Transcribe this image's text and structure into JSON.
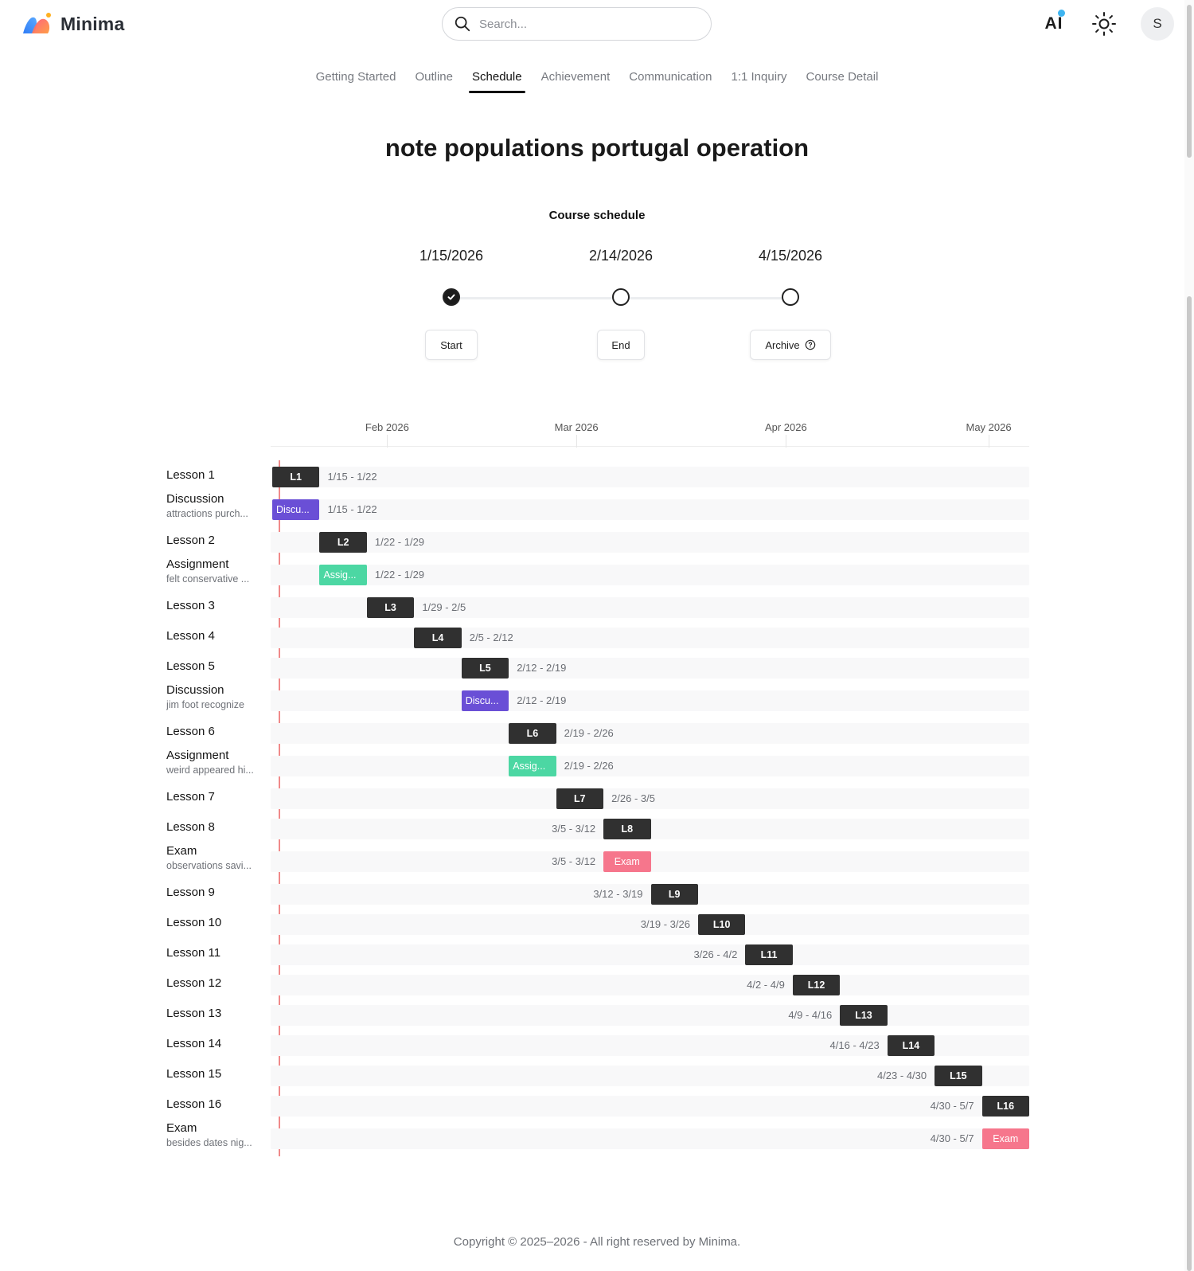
{
  "app": {
    "name": "Minima"
  },
  "header": {
    "search_placeholder": "Search...",
    "ai_label": "AI",
    "avatar_initial": "S"
  },
  "tabs": [
    {
      "label": "Getting Started",
      "active": false
    },
    {
      "label": "Outline",
      "active": false
    },
    {
      "label": "Schedule",
      "active": true
    },
    {
      "label": "Achievement",
      "active": false
    },
    {
      "label": "Communication",
      "active": false
    },
    {
      "label": "1:1 Inquiry",
      "active": false
    },
    {
      "label": "Course Detail",
      "active": false
    }
  ],
  "course": {
    "title": "note populations portugal operation",
    "schedule_heading": "Course schedule"
  },
  "milestones": [
    {
      "date": "1/15/2026",
      "label": "Start",
      "done": true
    },
    {
      "date": "2/14/2026",
      "label": "End",
      "done": false
    },
    {
      "date": "4/15/2026",
      "label": "Archive",
      "done": false,
      "info_icon": true
    }
  ],
  "timeline": {
    "range_start": "2026-01-15",
    "range_end": "2026-05-07",
    "months": [
      {
        "label": "Feb 2026",
        "date": "2026-02-01"
      },
      {
        "label": "Mar 2026",
        "date": "2026-03-01"
      },
      {
        "label": "Apr 2026",
        "date": "2026-04-01"
      },
      {
        "label": "May 2026",
        "date": "2026-05-01"
      }
    ],
    "today": "2026-01-16",
    "items": [
      {
        "name": "Lesson 1",
        "sub": "",
        "type": "lesson",
        "bar_label": "L1",
        "range": "1/15 - 1/22",
        "start": "2026-01-15",
        "end": "2026-01-22"
      },
      {
        "name": "Discussion",
        "sub": "attractions purch...",
        "type": "discussion",
        "bar_label": "Discu...",
        "range": "1/15 - 1/22",
        "start": "2026-01-15",
        "end": "2026-01-22"
      },
      {
        "name": "Lesson 2",
        "sub": "",
        "type": "lesson",
        "bar_label": "L2",
        "range": "1/22 - 1/29",
        "start": "2026-01-22",
        "end": "2026-01-29"
      },
      {
        "name": "Assignment",
        "sub": "felt conservative ...",
        "type": "assignment",
        "bar_label": "Assig...",
        "range": "1/22 - 1/29",
        "start": "2026-01-22",
        "end": "2026-01-29"
      },
      {
        "name": "Lesson 3",
        "sub": "",
        "type": "lesson",
        "bar_label": "L3",
        "range": "1/29 - 2/5",
        "start": "2026-01-29",
        "end": "2026-02-05"
      },
      {
        "name": "Lesson 4",
        "sub": "",
        "type": "lesson",
        "bar_label": "L4",
        "range": "2/5 - 2/12",
        "start": "2026-02-05",
        "end": "2026-02-12"
      },
      {
        "name": "Lesson 5",
        "sub": "",
        "type": "lesson",
        "bar_label": "L5",
        "range": "2/12 - 2/19",
        "start": "2026-02-12",
        "end": "2026-02-19"
      },
      {
        "name": "Discussion",
        "sub": "jim foot recognize",
        "type": "discussion",
        "bar_label": "Discu...",
        "range": "2/12 - 2/19",
        "start": "2026-02-12",
        "end": "2026-02-19"
      },
      {
        "name": "Lesson 6",
        "sub": "",
        "type": "lesson",
        "bar_label": "L6",
        "range": "2/19 - 2/26",
        "start": "2026-02-19",
        "end": "2026-02-26"
      },
      {
        "name": "Assignment",
        "sub": "weird appeared hi...",
        "type": "assignment",
        "bar_label": "Assig...",
        "range": "2/19 - 2/26",
        "start": "2026-02-19",
        "end": "2026-02-26"
      },
      {
        "name": "Lesson 7",
        "sub": "",
        "type": "lesson",
        "bar_label": "L7",
        "range": "2/26 - 3/5",
        "start": "2026-02-26",
        "end": "2026-03-05"
      },
      {
        "name": "Lesson 8",
        "sub": "",
        "type": "lesson",
        "bar_label": "L8",
        "range": "3/5 - 3/12",
        "start": "2026-03-05",
        "end": "2026-03-12"
      },
      {
        "name": "Exam",
        "sub": "observations savi...",
        "type": "exam",
        "bar_label": "Exam",
        "range": "3/5 - 3/12",
        "start": "2026-03-05",
        "end": "2026-03-12"
      },
      {
        "name": "Lesson 9",
        "sub": "",
        "type": "lesson",
        "bar_label": "L9",
        "range": "3/12 - 3/19",
        "start": "2026-03-12",
        "end": "2026-03-19"
      },
      {
        "name": "Lesson 10",
        "sub": "",
        "type": "lesson",
        "bar_label": "L10",
        "range": "3/19 - 3/26",
        "start": "2026-03-19",
        "end": "2026-03-26"
      },
      {
        "name": "Lesson 11",
        "sub": "",
        "type": "lesson",
        "bar_label": "L11",
        "range": "3/26 - 4/2",
        "start": "2026-03-26",
        "end": "2026-04-02"
      },
      {
        "name": "Lesson 12",
        "sub": "",
        "type": "lesson",
        "bar_label": "L12",
        "range": "4/2 - 4/9",
        "start": "2026-04-02",
        "end": "2026-04-09"
      },
      {
        "name": "Lesson 13",
        "sub": "",
        "type": "lesson",
        "bar_label": "L13",
        "range": "4/9 - 4/16",
        "start": "2026-04-09",
        "end": "2026-04-16"
      },
      {
        "name": "Lesson 14",
        "sub": "",
        "type": "lesson",
        "bar_label": "L14",
        "range": "4/16 - 4/23",
        "start": "2026-04-16",
        "end": "2026-04-23"
      },
      {
        "name": "Lesson 15",
        "sub": "",
        "type": "lesson",
        "bar_label": "L15",
        "range": "4/23 - 4/30",
        "start": "2026-04-23",
        "end": "2026-04-30"
      },
      {
        "name": "Lesson 16",
        "sub": "",
        "type": "lesson",
        "bar_label": "L16",
        "range": "4/30 - 5/7",
        "start": "2026-04-30",
        "end": "2026-05-07"
      },
      {
        "name": "Exam",
        "sub": "besides dates nig...",
        "type": "exam",
        "bar_label": "Exam",
        "range": "4/30 - 5/7",
        "start": "2026-04-30",
        "end": "2026-05-07"
      }
    ]
  },
  "colors": {
    "lesson": "#303030",
    "discussion": "#6a4fd6",
    "assignment": "#4cd7a3",
    "exam": "#f6768c",
    "today_line": "#f08a8a",
    "ai_dot": "#3fb4f0"
  },
  "footer": {
    "text": "Copyright © 2025–2026 - All right reserved by Minima."
  }
}
